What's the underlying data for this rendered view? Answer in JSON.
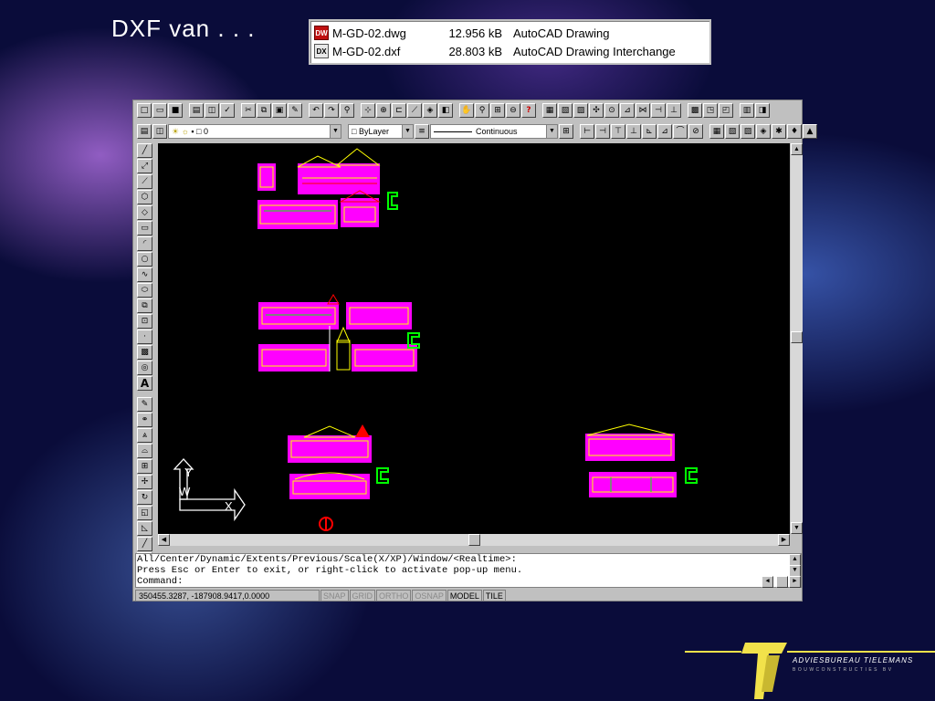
{
  "slide": {
    "title": "DXF van . . ."
  },
  "files": [
    {
      "icon": "dwg-file-icon",
      "name": "M-GD-02.dwg",
      "size": "12.956 kB",
      "type": "AutoCAD Drawing"
    },
    {
      "icon": "dxf-file-icon",
      "name": "M-GD-02.dxf",
      "size": "28.803 kB",
      "type": "AutoCAD Drawing Interchange"
    }
  ],
  "acad": {
    "layer_value": "0",
    "color_value": "ByLayer",
    "linetype_value": "Continuous",
    "command_lines": [
      "All/Center/Dynamic/Extents/Previous/Scale(X/XP)/Window/<Realtime>:",
      "Press Esc or Enter to exit, or right-click to activate pop-up menu.",
      "Command:"
    ],
    "status": {
      "coords": "350455.3287, -187908.9417,0.0000",
      "toggles": [
        {
          "label": "SNAP",
          "on": false
        },
        {
          "label": "GRID",
          "on": false
        },
        {
          "label": "ORTHO",
          "on": false
        },
        {
          "label": "OSNAP",
          "on": false
        },
        {
          "label": "MODEL",
          "on": true
        },
        {
          "label": "TILE",
          "on": true
        }
      ]
    },
    "ucs_labels": {
      "y": "Y",
      "w": "W",
      "x": "X"
    }
  },
  "logo": {
    "name": "ADVIESBUREAU TIELEMANS",
    "tagline": "BOUWCONSTRUCTIES BV"
  },
  "colors": {
    "drawing_bg": "#000000",
    "magenta": "#ff00ff",
    "yellow": "#ffff00",
    "green": "#00ff00",
    "red": "#ff0000",
    "logo_yellow": "#f2e24a"
  }
}
